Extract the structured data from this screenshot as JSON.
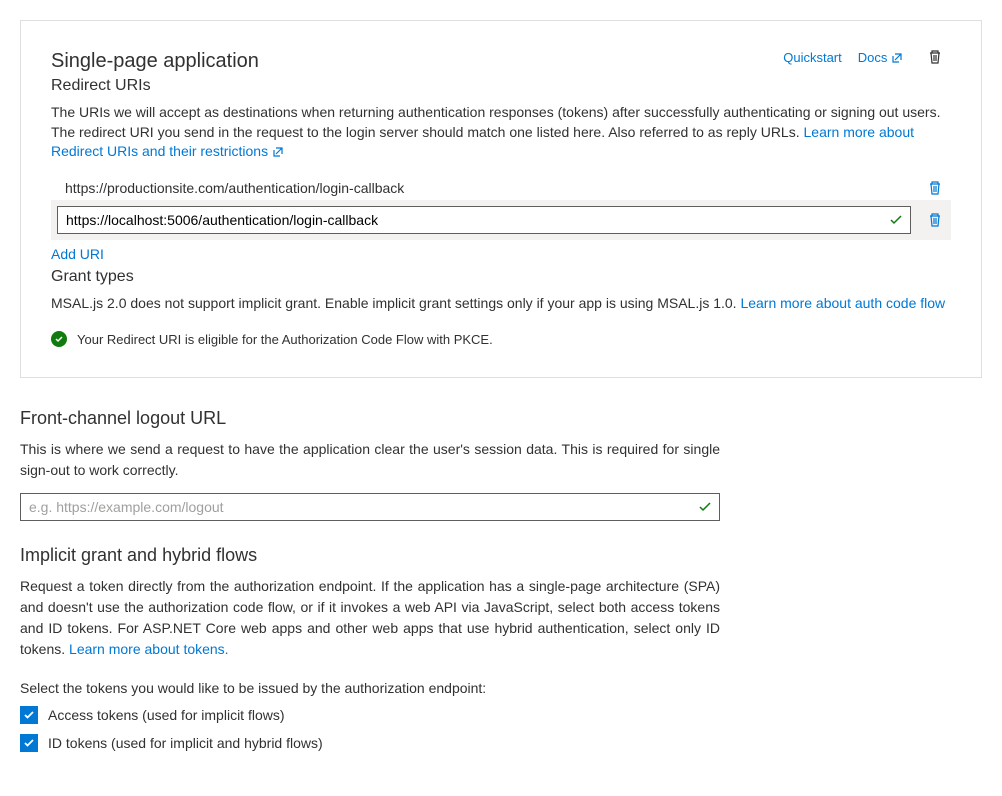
{
  "card": {
    "title": "Single-page application",
    "subtitle": "Redirect URIs",
    "quickstart": "Quickstart",
    "docs": "Docs",
    "description_pre": "The URIs we will accept as destinations when returning authentication responses (tokens) after successfully authenticating or signing out users. The redirect URI you send in the request to the login server should match one listed here. Also referred to as reply URLs. ",
    "learn_redirect": "Learn more about Redirect URIs and their restrictions",
    "uris": {
      "static": "https://productionsite.com/authentication/login-callback",
      "editing": "https://localhost:5006/authentication/login-callback"
    },
    "add_uri": "Add URI",
    "grant_title": "Grant types",
    "grant_desc_pre": "MSAL.js 2.0 does not support implicit grant. Enable implicit grant settings only if your app is using MSAL.js 1.0. ",
    "learn_auth": "Learn more about auth code flow",
    "status": "Your Redirect URI is eligible for the Authorization Code Flow with PKCE."
  },
  "logout": {
    "title": "Front-channel logout URL",
    "description": "This is where we send a request to have the application clear the user's session data. This is required for single sign-out to work correctly.",
    "placeholder": "e.g. https://example.com/logout"
  },
  "implicit": {
    "title": "Implicit grant and hybrid flows",
    "description_pre": "Request a token directly from the authorization endpoint. If the application has a single-page architecture (SPA) and doesn't use the authorization code flow, or if it invokes a web API via JavaScript, select both access tokens and ID tokens. For ASP.NET Core web apps and other web apps that use hybrid authentication, select only ID tokens. ",
    "learn_tokens": "Learn more about tokens.",
    "prompt": "Select the tokens you would like to be issued by the authorization endpoint:",
    "access_label": "Access tokens (used for implicit flows)",
    "id_label": "ID tokens (used for implicit and hybrid flows)"
  }
}
